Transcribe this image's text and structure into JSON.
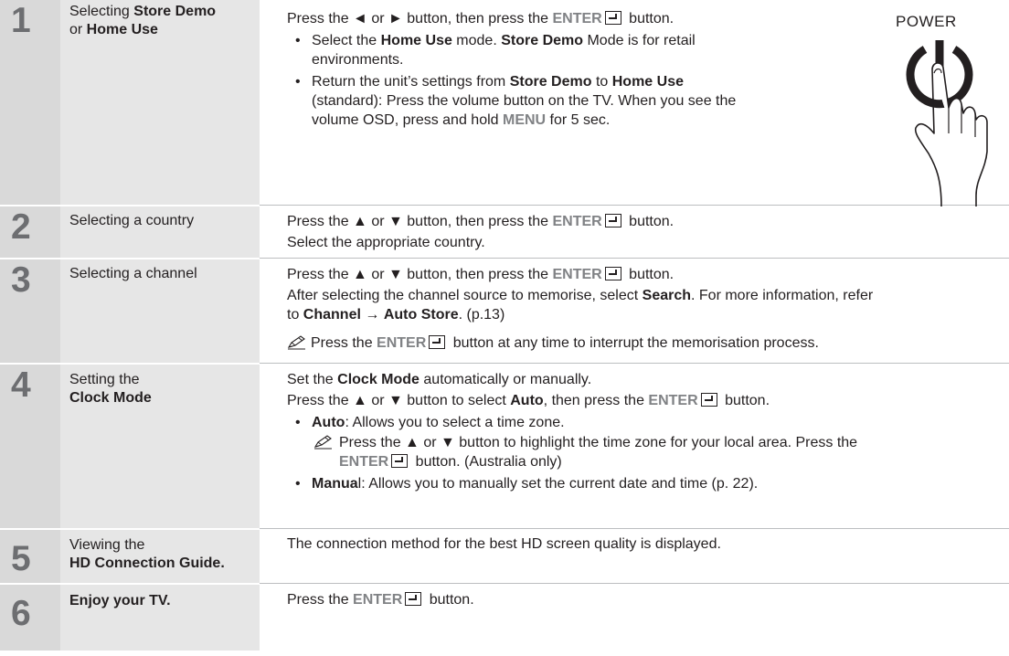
{
  "steps": [
    {
      "number": "1",
      "label_parts": [
        [
          "Selecting ",
          ""
        ],
        [
          "Store Demo",
          "b"
        ],
        [
          "\nor ",
          ""
        ],
        [
          "Home Use",
          "b"
        ]
      ],
      "lines": [
        {
          "kind": "p",
          "parts": [
            [
              "Press the ◄ or ► button, then press the ",
              ""
            ],
            [
              "ENTER",
              "g"
            ],
            [
              "",
              "enter"
            ],
            [
              " button.",
              ""
            ]
          ]
        },
        {
          "kind": "bullet",
          "parts": [
            [
              "Select the ",
              ""
            ],
            [
              "Home Use",
              "b"
            ],
            [
              " mode. ",
              ""
            ],
            [
              "Store Demo",
              "b"
            ],
            [
              " Mode is for retail\nenvironments.",
              ""
            ]
          ]
        },
        {
          "kind": "bullet",
          "parts": [
            [
              "Return the unit’s settings from ",
              ""
            ],
            [
              "Store Demo",
              "b"
            ],
            [
              " to ",
              ""
            ],
            [
              "Home Use",
              "b"
            ],
            [
              "\n(standard): Press the volume button on the TV. When you see the\nvolume OSD, press and hold ",
              ""
            ],
            [
              "MENU",
              "g"
            ],
            [
              " for 5 sec.",
              ""
            ]
          ]
        }
      ]
    },
    {
      "number": "2",
      "label_parts": [
        [
          "Selecting a country",
          ""
        ]
      ],
      "lines": [
        {
          "kind": "p",
          "parts": [
            [
              "Press the ▲ or ▼ button, then press the ",
              ""
            ],
            [
              "ENTER",
              "g"
            ],
            [
              "",
              "enter"
            ],
            [
              " button.",
              ""
            ]
          ]
        },
        {
          "kind": "p",
          "parts": [
            [
              "Select the appropriate country.",
              ""
            ]
          ]
        }
      ]
    },
    {
      "number": "3",
      "label_parts": [
        [
          "Selecting a channel",
          ""
        ]
      ],
      "lines": [
        {
          "kind": "p",
          "parts": [
            [
              "Press the ▲ or ▼ button, then press the ",
              ""
            ],
            [
              "ENTER",
              "g"
            ],
            [
              "",
              "enter"
            ],
            [
              " button.",
              ""
            ]
          ]
        },
        {
          "kind": "p",
          "parts": [
            [
              "After selecting the channel source to memorise, select ",
              ""
            ],
            [
              "Search",
              "b"
            ],
            [
              ". For more information, refer\nto ",
              ""
            ],
            [
              "Channel",
              "b"
            ],
            [
              " → ",
              ""
            ],
            [
              "Auto Store",
              "b"
            ],
            [
              ". (p.13)",
              ""
            ]
          ]
        },
        {
          "kind": "note-inline",
          "parts": [
            [
              "Press the ",
              ""
            ],
            [
              "ENTER",
              "g"
            ],
            [
              "",
              "enter"
            ],
            [
              " button at any time to interrupt the memorisation process.",
              ""
            ]
          ]
        }
      ]
    },
    {
      "number": "4",
      "label_parts": [
        [
          "Setting the\n",
          ""
        ],
        [
          "Clock Mode",
          "b"
        ]
      ],
      "lines": [
        {
          "kind": "p",
          "parts": [
            [
              "Set the ",
              ""
            ],
            [
              "Clock Mode",
              "b"
            ],
            [
              " automatically or manually.",
              ""
            ]
          ]
        },
        {
          "kind": "p",
          "parts": [
            [
              "Press the ▲ or ▼ button to select ",
              ""
            ],
            [
              "Auto",
              "b"
            ],
            [
              ", then press the ",
              ""
            ],
            [
              "ENTER",
              "g"
            ],
            [
              "",
              "enter"
            ],
            [
              " button.",
              ""
            ]
          ]
        },
        {
          "kind": "bullet",
          "parts": [
            [
              "Auto",
              "b"
            ],
            [
              ": Allows you to select a time zone.",
              ""
            ]
          ]
        },
        {
          "kind": "subnote",
          "parts": [
            [
              "Press the ▲ or ▼ button to highlight the time zone for your local area. Press the\n",
              ""
            ],
            [
              "ENTER",
              "g"
            ],
            [
              "",
              "enter"
            ],
            [
              " button. (Australia only)",
              ""
            ]
          ]
        },
        {
          "kind": "bullet",
          "parts": [
            [
              "Manua",
              "b"
            ],
            [
              "l: Allows you to manually set the current date and time (p. 22).",
              ""
            ]
          ]
        }
      ]
    },
    {
      "number": "5",
      "label_parts": [
        [
          "Viewing the\n",
          ""
        ],
        [
          "HD Connection Guide.",
          "b"
        ]
      ],
      "lines": [
        {
          "kind": "p",
          "parts": [
            [
              "The connection method for the best HD screen quality is displayed.",
              ""
            ]
          ]
        }
      ]
    },
    {
      "number": "6",
      "label_parts": [
        [
          "Enjoy your TV.",
          "b"
        ]
      ],
      "lines": [
        {
          "kind": "p",
          "parts": [
            [
              "Press the ",
              ""
            ],
            [
              "ENTER",
              "g"
            ],
            [
              "",
              "enter"
            ],
            [
              " button.",
              ""
            ]
          ]
        }
      ]
    }
  ],
  "power_label": "POWER"
}
